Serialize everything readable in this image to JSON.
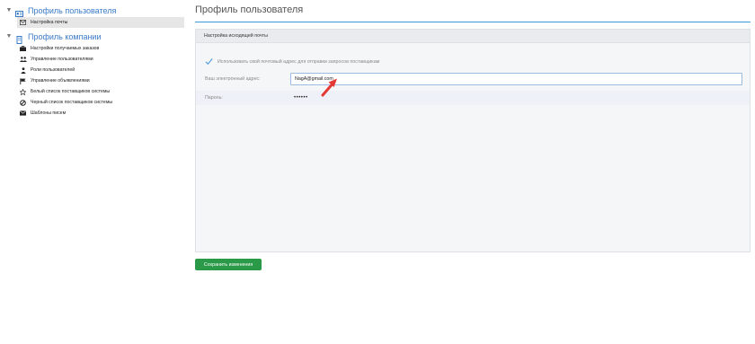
{
  "sidebar": {
    "user_profile": {
      "label": "Профиль пользователя",
      "items": [
        {
          "label": "Настройка почты",
          "icon": "envelope-icon",
          "selected": true
        }
      ]
    },
    "company_profile": {
      "label": "Профиль компании",
      "items": [
        {
          "label": "Настройки получаемых заказов",
          "icon": "briefcase-icon"
        },
        {
          "label": "Управление пользователями",
          "icon": "users-icon"
        },
        {
          "label": "Роли пользователей",
          "icon": "user-lock-icon"
        },
        {
          "label": "Управление объявлениями",
          "icon": "flag-icon"
        },
        {
          "label": "Белый список поставщиков системы",
          "icon": "star-outline-icon"
        },
        {
          "label": "Черный список поставщиков системы",
          "icon": "ban-icon"
        },
        {
          "label": "Шаблоны писем",
          "icon": "envelope-filled-icon"
        }
      ]
    }
  },
  "main": {
    "title": "Профиль пользователя",
    "panel": {
      "heading": "Настройка исходящей почты",
      "use_own_mail": {
        "label": "Использовать свой почтовый адрес для отправки запросов поставщикам",
        "checked": true
      },
      "email": {
        "label": "Ваш электронный адрес:",
        "value": "NagA@gmail.com"
      },
      "password": {
        "label": "Пароль:",
        "value": "••••••"
      }
    },
    "save_button": "Сохранить изменения"
  },
  "colors": {
    "accent": "#3a7bc8",
    "rule": "#3a9ad9",
    "save": "#2a9a49",
    "arrow": "#e53935"
  }
}
